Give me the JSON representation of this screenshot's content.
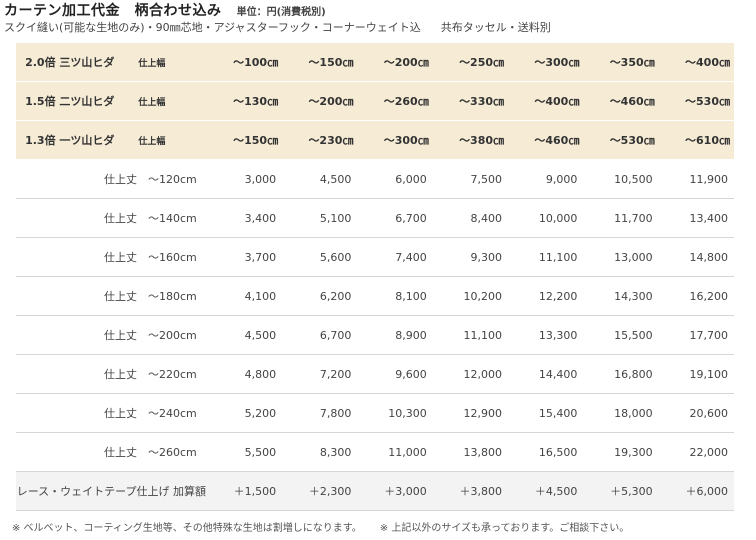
{
  "title": "カーテン加工代金　柄合わせ込み",
  "unit_note": "単位：円(消費税別)",
  "subtitle_left": "スクイ縫い(可能な生地のみ)・90㎜芯地・アジャスターフック・コーナーウェイト込",
  "subtitle_right": "共布タッセル・送料別",
  "header_rows": [
    {
      "fold": "2.0倍 三ツ山ヒダ",
      "width_label": "仕上幅",
      "ranges": [
        "～100㎝",
        "～150㎝",
        "～200㎝",
        "～250㎝",
        "～300㎝",
        "～350㎝",
        "～400㎝"
      ]
    },
    {
      "fold": "1.5倍 二ツ山ヒダ",
      "width_label": "仕上幅",
      "ranges": [
        "～130㎝",
        "～200㎝",
        "～260㎝",
        "～330㎝",
        "～400㎝",
        "～460㎝",
        "～530㎝"
      ]
    },
    {
      "fold": "1.3倍 一ツ山ヒダ",
      "width_label": "仕上幅",
      "ranges": [
        "～150㎝",
        "～230㎝",
        "～300㎝",
        "～380㎝",
        "～460㎝",
        "～530㎝",
        "～610㎝"
      ]
    }
  ],
  "price_rows": [
    {
      "label": "仕上丈　～120cm",
      "values": [
        "3,000",
        "4,500",
        "6,000",
        "7,500",
        "9,000",
        "10,500",
        "11,900"
      ]
    },
    {
      "label": "仕上丈　～140cm",
      "values": [
        "3,400",
        "5,100",
        "6,700",
        "8,400",
        "10,000",
        "11,700",
        "13,400"
      ]
    },
    {
      "label": "仕上丈　～160cm",
      "values": [
        "3,700",
        "5,600",
        "7,400",
        "9,300",
        "11,100",
        "13,000",
        "14,800"
      ]
    },
    {
      "label": "仕上丈　～180cm",
      "values": [
        "4,100",
        "6,200",
        "8,100",
        "10,200",
        "12,200",
        "14,300",
        "16,200"
      ]
    },
    {
      "label": "仕上丈　～200cm",
      "values": [
        "4,500",
        "6,700",
        "8,900",
        "11,100",
        "13,300",
        "15,500",
        "17,700"
      ]
    },
    {
      "label": "仕上丈　～220cm",
      "values": [
        "4,800",
        "7,200",
        "9,600",
        "12,000",
        "14,400",
        "16,800",
        "19,100"
      ]
    },
    {
      "label": "仕上丈　～240cm",
      "values": [
        "5,200",
        "7,800",
        "10,300",
        "12,900",
        "15,400",
        "18,000",
        "20,600"
      ]
    },
    {
      "label": "仕上丈　～260cm",
      "values": [
        "5,500",
        "8,300",
        "11,000",
        "13,800",
        "16,500",
        "19,300",
        "22,000"
      ]
    }
  ],
  "surcharge_row": {
    "label": "レース・ウェイトテープ仕上げ 加算額",
    "values": [
      "＋1,500",
      "＋2,300",
      "＋3,000",
      "＋3,800",
      "＋4,500",
      "＋5,300",
      "＋6,000"
    ]
  },
  "footnote_left": "※ ベルベット、コーティング生地等、その他特殊な生地は割増しになります。",
  "footnote_right": "※ 上記以外のサイズも承っております。ご相談下さい。"
}
